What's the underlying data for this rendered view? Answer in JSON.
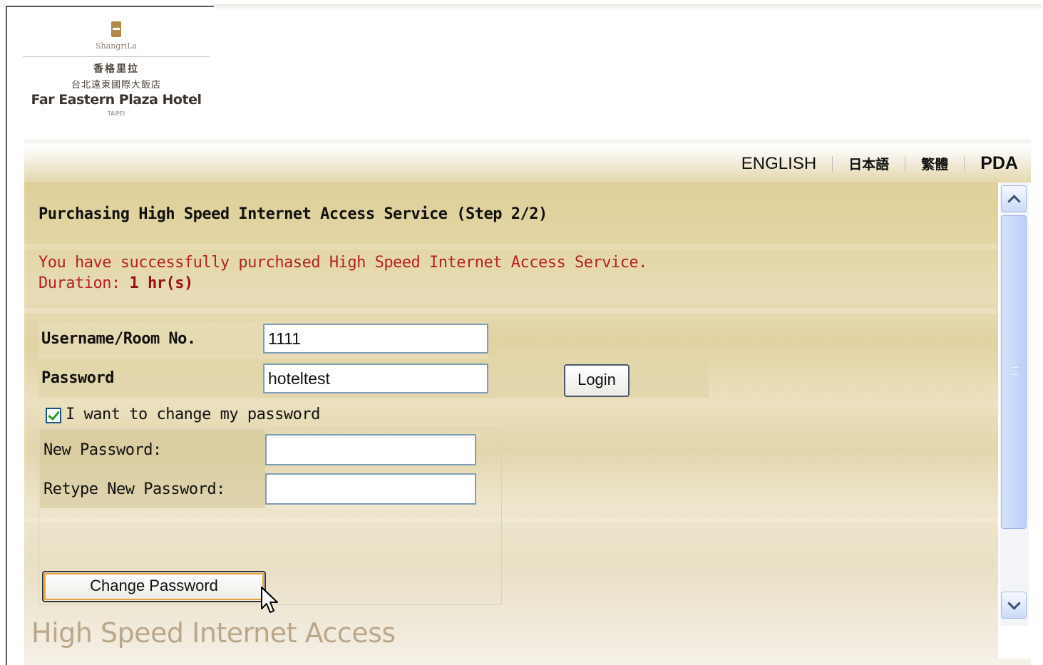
{
  "logo": {
    "brand_small": "ShangriLa",
    "name_cjk_1": "香格里拉",
    "name_cjk_2": "台北遠東國際大飯店",
    "name_en": "Far Eastern Plaza Hotel",
    "city": "TAIPEI"
  },
  "languages": [
    "ENGLISH",
    "日本語",
    "繁體",
    "PDA"
  ],
  "page": {
    "title": "Purchasing High Speed Internet Access Service (Step 2/2)",
    "success_message": "You have successfully purchased High Speed Internet Access Service.",
    "duration_label": "Duration:",
    "duration_value": "1 hr(s)"
  },
  "login_form": {
    "username_label": "Username/Room No.",
    "username_value": "1111",
    "password_label": "Password",
    "password_value": "hoteltest",
    "login_button": "Login"
  },
  "change_password": {
    "checkbox_label": "I want to change my password",
    "checked": true,
    "new_password_label": "New Password:",
    "new_password_value": "",
    "retype_label": "Retype New Password:",
    "retype_value": "",
    "button": "Change Password"
  },
  "footer": {
    "title": "High Speed Internet Access"
  },
  "colors": {
    "accent_red": "#b22222",
    "panel_tan": "#e2d5a3",
    "input_border": "#7f9db9"
  },
  "icons": [
    "scroll-up-icon",
    "scroll-down-icon",
    "checkbox-check-icon",
    "mouse-cursor-icon"
  ]
}
